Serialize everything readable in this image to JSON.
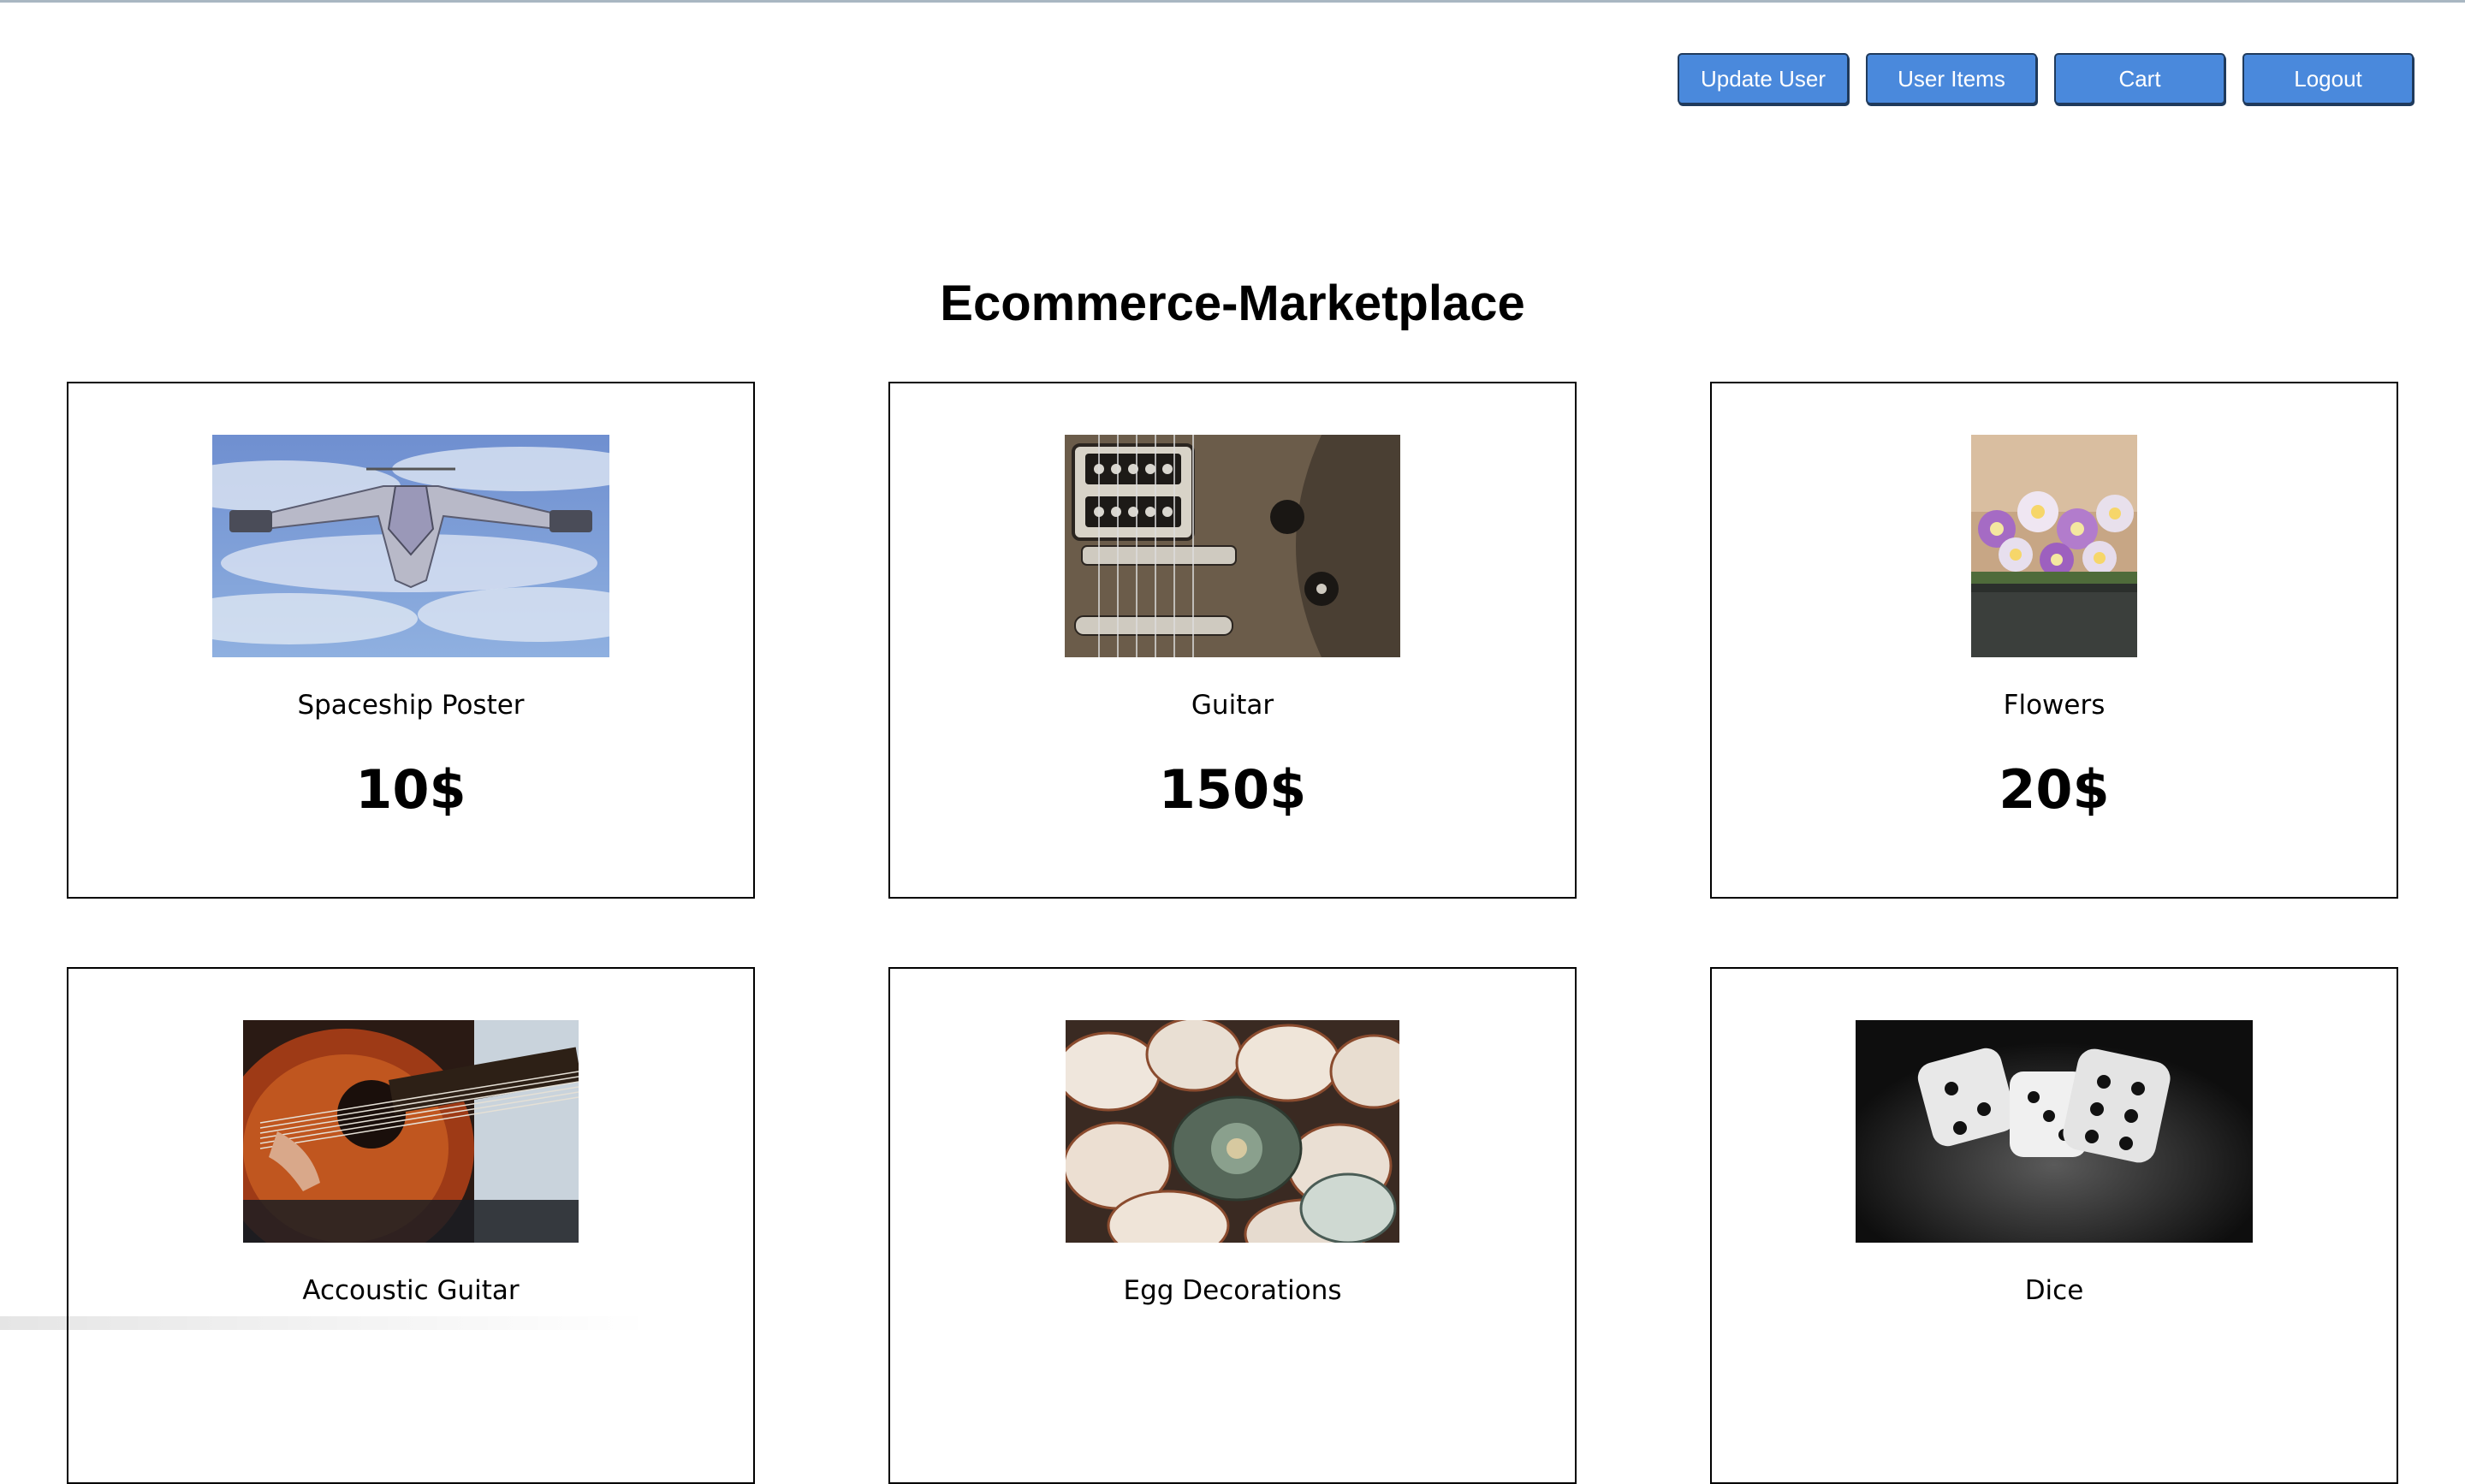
{
  "nav": {
    "update_user": "Update User",
    "user_items": "User Items",
    "cart": "Cart",
    "logout": "Logout"
  },
  "page": {
    "title": "Ecommerce-Marketplace"
  },
  "colors": {
    "button_fill": "#4a89dc",
    "button_border": "#1f3a5c",
    "card_border": "#000000"
  },
  "products": [
    {
      "name": "Spaceship Poster",
      "price": "10$",
      "image": "spaceship-image"
    },
    {
      "name": "Guitar",
      "price": "150$",
      "image": "electric-guitar-image"
    },
    {
      "name": "Flowers",
      "price": "20$",
      "image": "flowers-image"
    },
    {
      "name": "Accoustic Guitar",
      "price": "",
      "image": "acoustic-guitar-image"
    },
    {
      "name": "Egg Decorations",
      "price": "",
      "image": "egg-decorations-image"
    },
    {
      "name": "Dice",
      "price": "",
      "image": "dice-image"
    }
  ]
}
